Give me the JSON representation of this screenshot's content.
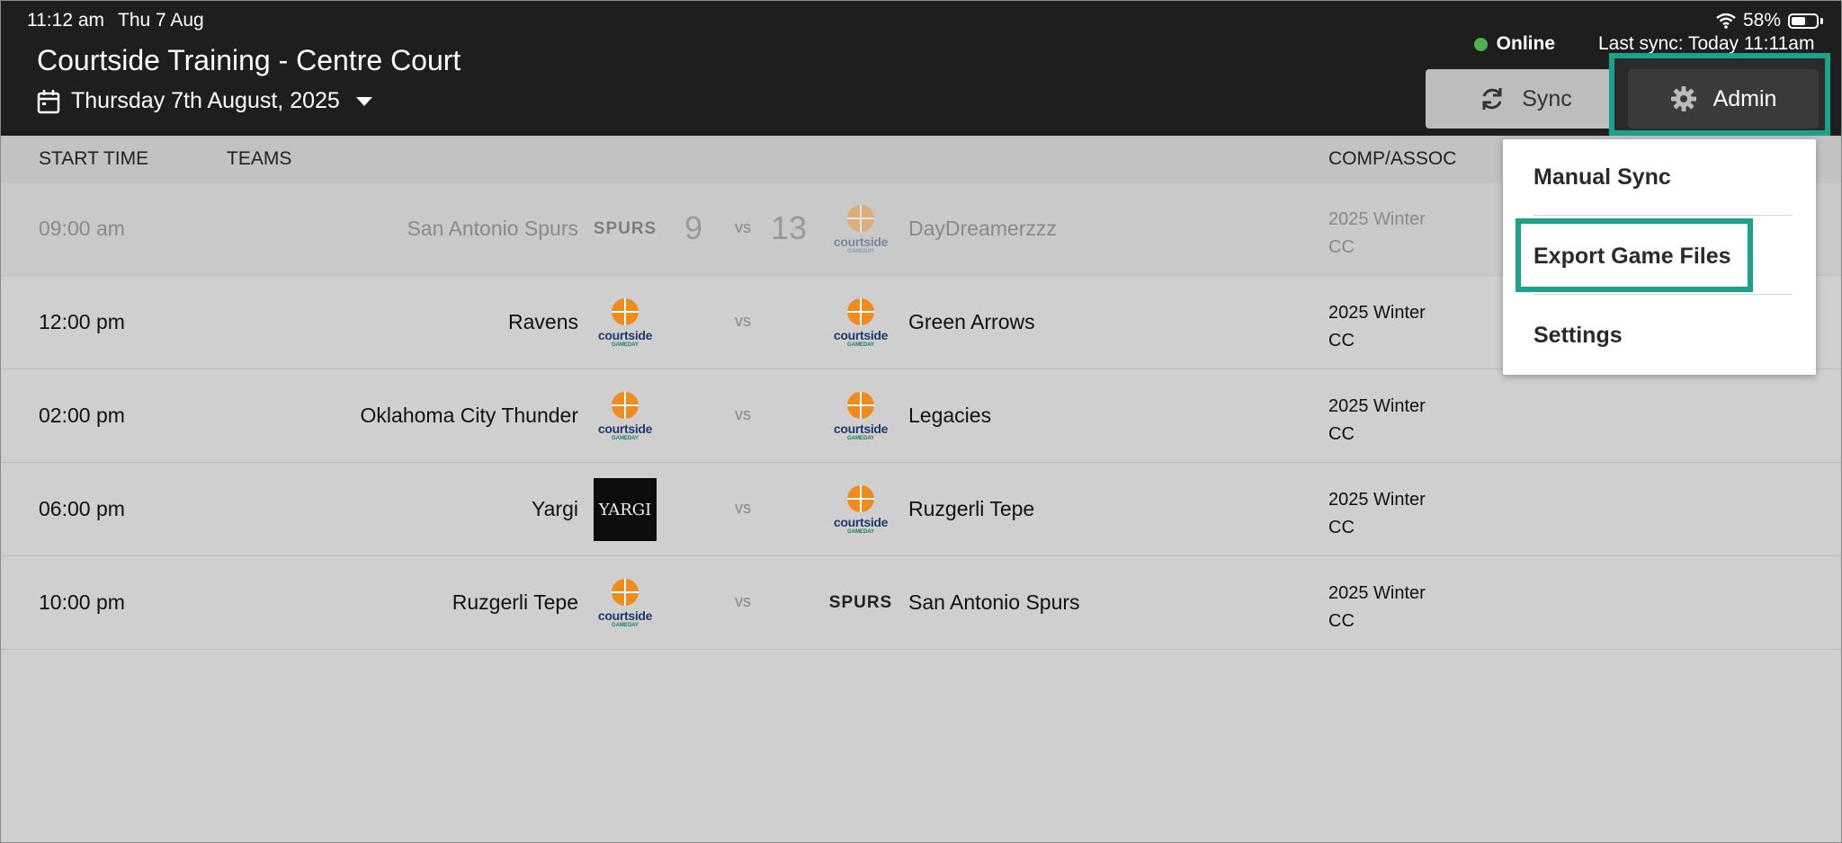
{
  "status_bar": {
    "time": "11:12 am",
    "date": "Thu 7 Aug",
    "battery": "58%",
    "battery_level": 0.58
  },
  "header": {
    "title": "Courtside Training - Centre Court",
    "date": "Thursday 7th August, 2025",
    "online_label": "Online",
    "last_sync": "Last sync: Today 11:11am",
    "sync_label": "Sync",
    "admin_label": "Admin"
  },
  "columns": {
    "start_time": "START TIME",
    "teams": "TEAMS",
    "comp": "COMP/ASSOC"
  },
  "games": [
    {
      "time": "09:00 am",
      "home": "San Antonio Spurs",
      "home_score": "9",
      "vs": "vs",
      "away_score": "13",
      "away": "DayDreamerzzz",
      "comp": "2025 Winter",
      "assoc": "CC"
    },
    {
      "time": "12:00 pm",
      "home": "Ravens",
      "vs": "vs",
      "away": "Green Arrows",
      "comp": "2025 Winter",
      "assoc": "CC"
    },
    {
      "time": "02:00 pm",
      "home": "Oklahoma City Thunder",
      "vs": "vs",
      "away": "Legacies",
      "comp": "2025 Winter",
      "assoc": "CC"
    },
    {
      "time": "06:00 pm",
      "home": "Yargi",
      "vs": "vs",
      "away": "Ruzgerli Tepe",
      "comp": "2025 Winter",
      "assoc": "CC"
    },
    {
      "time": "10:00 pm",
      "home": "Ruzgerli Tepe",
      "vs": "vs",
      "away": "San Antonio Spurs",
      "comp": "2025 Winter",
      "assoc": "CC"
    }
  ],
  "logos": {
    "courtside": "courtside",
    "gameday": "GAMEDAY",
    "spurs": "SPURS",
    "yargi": "YARGI"
  },
  "admin_menu": {
    "manual_sync": "Manual Sync",
    "export": "Export Game Files",
    "settings": "Settings"
  },
  "colors": {
    "highlight": "#1aa38a",
    "online": "#4caf50",
    "header_bg": "#1e1e1e"
  }
}
